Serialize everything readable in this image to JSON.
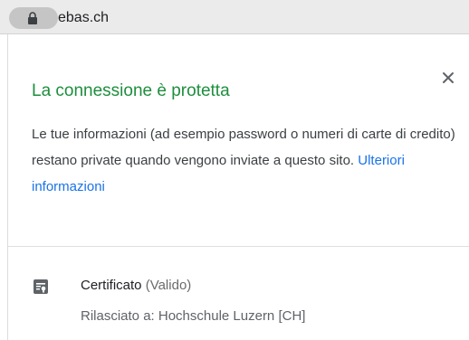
{
  "address_bar": {
    "domain": "ebas.ch",
    "lock_icon": "lock-icon"
  },
  "popup": {
    "title": "La connessione è protetta",
    "close_icon": "close-icon",
    "description": "Le tue informazioni (ad esempio password o numeri di carte di credito) restano private quando vengono inviate a questo sito.",
    "learn_more": "Ulteriori informazioni",
    "certificate": {
      "icon": "certificate-icon",
      "label": "Certificato",
      "status": "(Valido)",
      "issued_to": "Rilasciato a: Hochschule Luzern [CH]"
    }
  },
  "colors": {
    "title_green": "#1e8e3e",
    "link_blue": "#1a73e8",
    "addressbar_bg": "#ebebeb"
  }
}
